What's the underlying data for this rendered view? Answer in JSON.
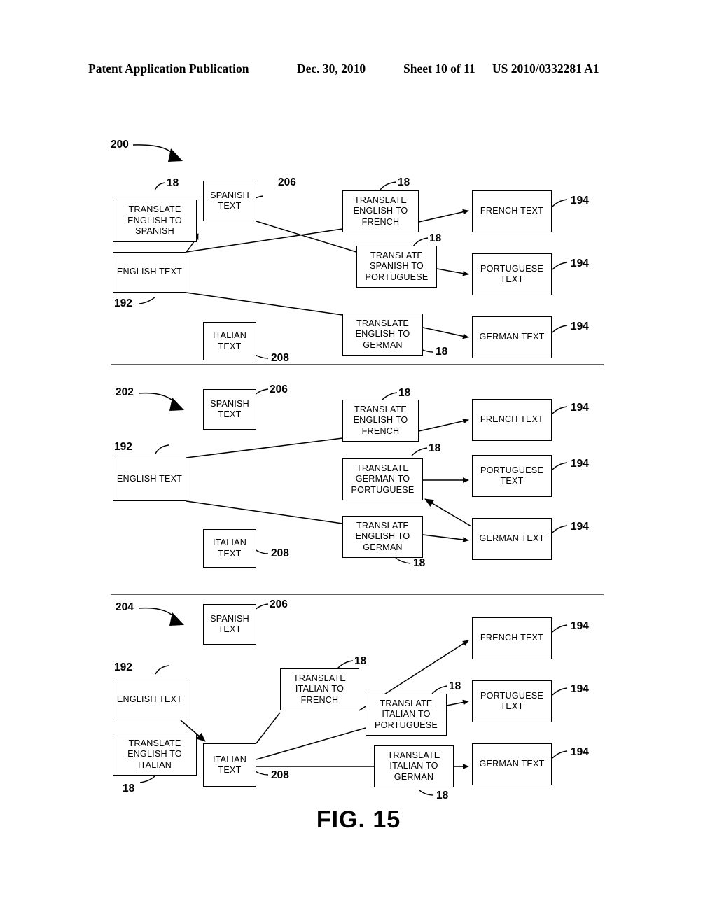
{
  "header": {
    "title": "Patent Application Publication",
    "date": "Dec. 30, 2010",
    "sheet": "Sheet 10 of 11",
    "number": "US 2010/0332281 A1"
  },
  "figure": {
    "caption": "FIG. 15"
  },
  "labels": {
    "translate_english_to_spanish": "TRANSLATE ENGLISH TO SPANISH",
    "translate_english_to_french": "TRANSLATE ENGLISH TO FRENCH",
    "translate_english_to_german": "TRANSLATE ENGLISH TO GERMAN",
    "translate_english_to_italian": "TRANSLATE ENGLISH TO ITALIAN",
    "translate_spanish_to_portuguese": "TRANSLATE SPANISH TO PORTUGUESE",
    "translate_german_to_portuguese": "TRANSLATE GERMAN TO PORTUGUESE",
    "translate_italian_to_french": "TRANSLATE ITALIAN TO FRENCH",
    "translate_italian_to_portuguese": "TRANSLATE ITALIAN TO PORTUGUESE",
    "translate_italian_to_german": "TRANSLATE ITALIAN TO GERMAN",
    "english_text": "ENGLISH TEXT",
    "spanish_text": "SPANISH TEXT",
    "italian_text": "ITALIAN TEXT",
    "french_text": "FRENCH TEXT",
    "portuguese_text": "PORTUGUESE TEXT",
    "german_text": "GERMAN TEXT"
  },
  "refs": {
    "r18": "18",
    "r192": "192",
    "r194": "194",
    "r200": "200",
    "r202": "202",
    "r204": "204",
    "r206": "206",
    "r208": "208"
  },
  "diagrams": [
    {
      "id": "200",
      "ref": "200",
      "boxes": [
        {
          "name": "translate-english-to-spanish",
          "label": "translate_english_to_spanish"
        },
        {
          "name": "english-text",
          "label": "english_text"
        },
        {
          "name": "spanish-text",
          "label": "spanish_text"
        },
        {
          "name": "italian-text",
          "label": "italian_text"
        },
        {
          "name": "translate-english-to-french",
          "label": "translate_english_to_french"
        },
        {
          "name": "translate-spanish-to-portuguese",
          "label": "translate_spanish_to_portuguese"
        },
        {
          "name": "translate-english-to-german",
          "label": "translate_english_to_german"
        },
        {
          "name": "french-text",
          "label": "french_text"
        },
        {
          "name": "portuguese-text",
          "label": "portuguese_text"
        },
        {
          "name": "german-text",
          "label": "german_text"
        }
      ],
      "connections": [
        "english-text -> translate-english-to-spanish -> spanish-text",
        "spanish-text -> translate-spanish-to-portuguese -> portuguese-text",
        "english-text -> translate-english-to-french -> french-text",
        "english-text -> translate-english-to-german -> german-text"
      ]
    },
    {
      "id": "202",
      "ref": "202",
      "boxes": [
        {
          "name": "spanish-text",
          "label": "spanish_text"
        },
        {
          "name": "english-text",
          "label": "english_text"
        },
        {
          "name": "italian-text",
          "label": "italian_text"
        },
        {
          "name": "translate-english-to-french",
          "label": "translate_english_to_french"
        },
        {
          "name": "translate-german-to-portuguese",
          "label": "translate_german_to_portuguese"
        },
        {
          "name": "translate-english-to-german",
          "label": "translate_english_to_german"
        },
        {
          "name": "french-text",
          "label": "french_text"
        },
        {
          "name": "portuguese-text",
          "label": "portuguese_text"
        },
        {
          "name": "german-text",
          "label": "german_text"
        }
      ],
      "connections": [
        "english-text -> translate-english-to-french -> french-text",
        "english-text -> translate-english-to-german -> german-text",
        "german-text -> translate-german-to-portuguese -> portuguese-text"
      ]
    },
    {
      "id": "204",
      "ref": "204",
      "boxes": [
        {
          "name": "spanish-text",
          "label": "spanish_text"
        },
        {
          "name": "english-text",
          "label": "english_text"
        },
        {
          "name": "translate-english-to-italian",
          "label": "translate_english_to_italian"
        },
        {
          "name": "italian-text",
          "label": "italian_text"
        },
        {
          "name": "translate-italian-to-french",
          "label": "translate_italian_to_french"
        },
        {
          "name": "translate-italian-to-portuguese",
          "label": "translate_italian_to_portuguese"
        },
        {
          "name": "translate-italian-to-german",
          "label": "translate_italian_to_german"
        },
        {
          "name": "french-text",
          "label": "french_text"
        },
        {
          "name": "portuguese-text",
          "label": "portuguese_text"
        },
        {
          "name": "german-text",
          "label": "german_text"
        }
      ],
      "connections": [
        "english-text -> translate-english-to-italian -> italian-text",
        "italian-text -> translate-italian-to-french -> french-text",
        "italian-text -> translate-italian-to-portuguese -> portuguese-text",
        "italian-text -> translate-italian-to-german -> german-text"
      ]
    }
  ]
}
